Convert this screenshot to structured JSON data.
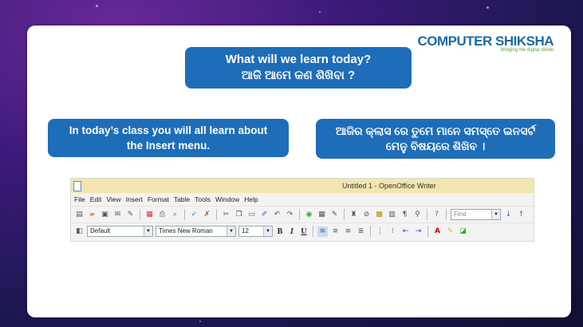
{
  "logo": {
    "brand_a": "COMPUTER",
    "brand_b": "SHIKSHA",
    "tagline": "bridging the digital divide"
  },
  "title": {
    "line1": "What will we learn today?",
    "line2": "ଆଜି ଆମେ କଣ ଶିଖିବା ?"
  },
  "left_text": {
    "line1": "In today’s class you will all learn about",
    "line2": "the Insert menu."
  },
  "right_text": {
    "line1": "ଆଜିର କ୍ଲାସ ରେ ତୁମେ ମାନେ ସମସ୍ତେ ଇନସର୍ଟ",
    "line2": "ମେନୁ ବିଷୟରେ ଶିଖିବ ।"
  },
  "writer": {
    "window_title": "Untitled 1 - OpenOffice Writer",
    "menu": [
      "File",
      "Edit",
      "View",
      "Insert",
      "Format",
      "Table",
      "Tools",
      "Window",
      "Help"
    ],
    "find_placeholder": "Find",
    "paragraph_style": "Default",
    "font_name": "Times New Roman",
    "font_size": "12",
    "fmt": {
      "bold": "B",
      "italic": "I",
      "underline": "U"
    }
  },
  "colors": {
    "box_blue": "#1e6db9",
    "brand_blue": "#1c6aa6"
  }
}
